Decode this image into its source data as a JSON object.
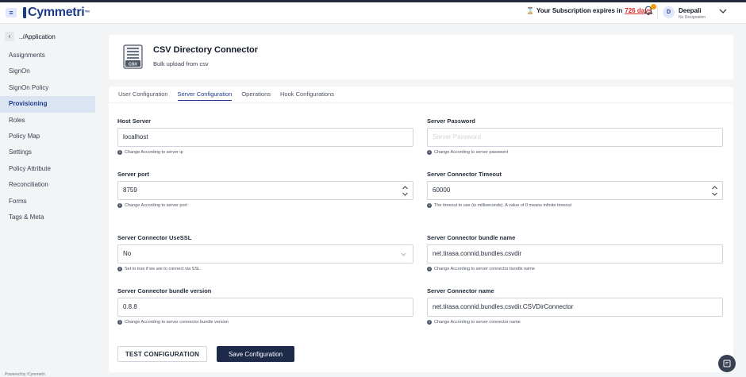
{
  "app": {
    "logo_text": "Cymmetri",
    "logo_tm": "™"
  },
  "topbar": {
    "subscription_prefix": "Your Subscription expires in",
    "subscription_days": "726 days",
    "notification_count": "",
    "user_initial": "D",
    "user_name": "Deepali",
    "user_role": "No Designation"
  },
  "sidebar": {
    "back_label": "../Application",
    "items": [
      {
        "label": "Assignments"
      },
      {
        "label": "SignOn"
      },
      {
        "label": "SignOn Policy"
      },
      {
        "label": "Provisioning",
        "active": true
      },
      {
        "label": "Roles"
      },
      {
        "label": "Policy Map"
      },
      {
        "label": "Settings"
      },
      {
        "label": "Policy Attribute"
      },
      {
        "label": "Reconciliation"
      },
      {
        "label": "Forms"
      },
      {
        "label": "Tags & Meta"
      }
    ],
    "powered_by": "Powered by ⁞Cymmetri"
  },
  "header": {
    "icon_text": "CSV",
    "title": "CSV Directory Connector",
    "subtitle": "Bulk upload from csv"
  },
  "tabs": [
    {
      "label": "User Configuration"
    },
    {
      "label": "Server Configuration",
      "active": true
    },
    {
      "label": "Operations"
    },
    {
      "label": "Hook Configurations"
    }
  ],
  "fields": {
    "host_server": {
      "label": "Host Server",
      "value": "localhost",
      "hint": "Change According to server ip"
    },
    "server_password": {
      "label": "Server Password",
      "placeholder": "Server Password",
      "hint": "Change According to server password"
    },
    "server_port": {
      "label": "Server port",
      "value": "8759",
      "hint": "Change According to server port"
    },
    "connector_timeout": {
      "label": "Server Connector Timeout",
      "value": "60000",
      "hint": "The timeout to use (in milliseconds). A value of 0 means infinite timeout"
    },
    "use_ssl": {
      "label": "Server Connector UseSSL",
      "value": "No",
      "hint": "Set to true if we are to connect via SSL."
    },
    "bundle_name": {
      "label": "Server Connector bundle name",
      "value": "net.tirasa.connid.bundles.csvdir",
      "hint": "Change According to server connector bundle name"
    },
    "bundle_version": {
      "label": "Server Connector bundle version",
      "value": "0.8.8",
      "hint": "Change According to server connector bundle version"
    },
    "connector_name": {
      "label": "Server Connector name",
      "value": "net.tirasa.connid.bundles.csvdir.CSVDirConnector",
      "hint": "Change According to server connector name"
    }
  },
  "buttons": {
    "test": "TEST CONFIGURATION",
    "save": "Save Configuration"
  },
  "icons": {
    "menu": "menu-icon",
    "bell": "bell-icon",
    "hourglass": "hourglass-icon",
    "chevron": "chevron-down-icon",
    "info": "info-icon",
    "csv": "csv-file-icon",
    "chat": "chat-icon"
  },
  "colors": {
    "brand": "#1e3a8a",
    "primary_button": "#1e2a4a",
    "accent_warning": "#dc2626",
    "active_nav_bg": "#dbe4f3"
  }
}
